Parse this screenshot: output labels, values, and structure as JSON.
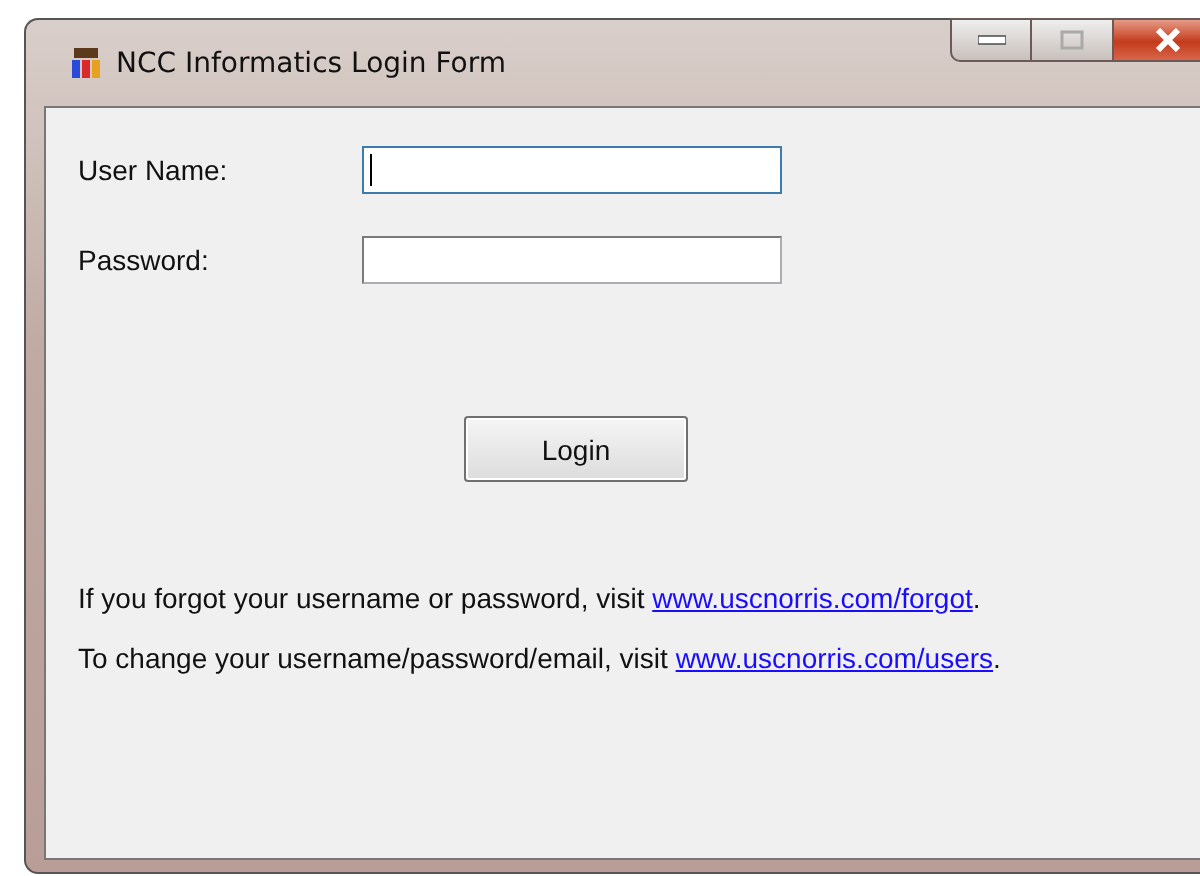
{
  "window": {
    "title": "NCC Informatics Login Form"
  },
  "fields": [
    {
      "label": "User Name:",
      "focused": true
    },
    {
      "label": "Password:",
      "focused": false
    }
  ],
  "login_button": "Login",
  "help_lines": [
    {
      "text": "If you forgot your username or password, visit ",
      "link": "www.uscnorris.com/forgot",
      "after": "."
    },
    {
      "text": "To change your username/password/email, visit ",
      "link": "www.uscnorris.com/users",
      "after": "."
    }
  ]
}
